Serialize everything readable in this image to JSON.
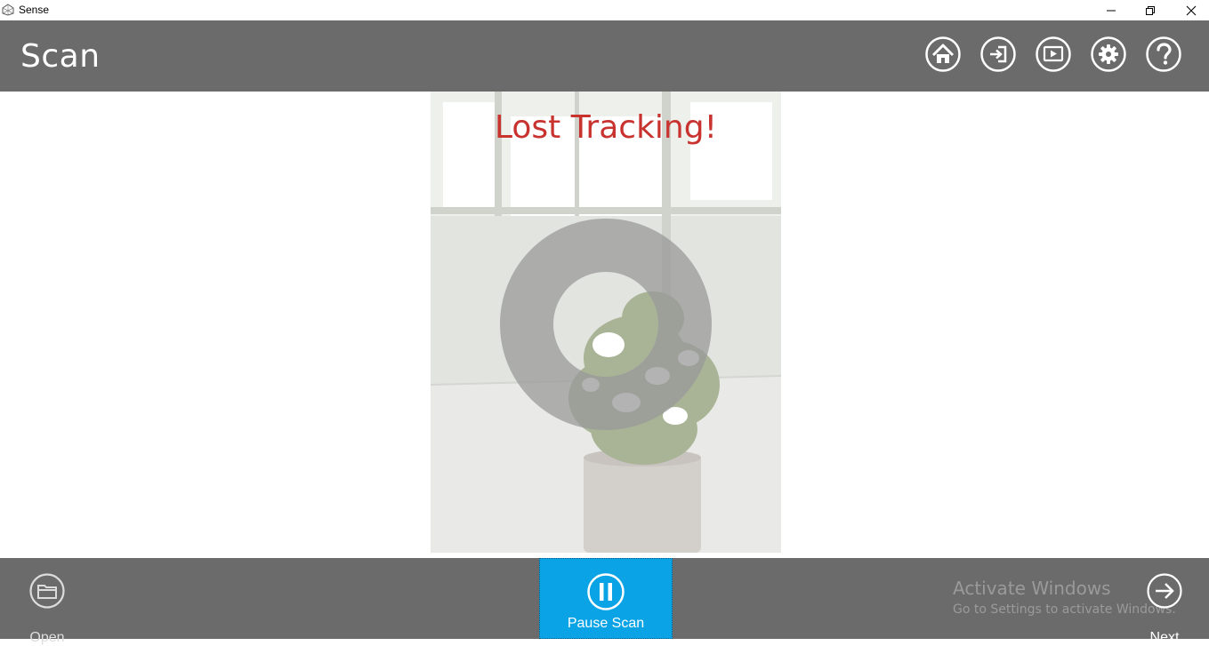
{
  "window": {
    "title": "Sense",
    "controls": [
      "minimize",
      "restore",
      "close"
    ]
  },
  "header": {
    "title": "Scan",
    "buttons": [
      {
        "icon": "home-icon"
      },
      {
        "icon": "sign-in-icon"
      },
      {
        "icon": "play-icon"
      },
      {
        "icon": "gear-icon"
      },
      {
        "icon": "help-icon"
      }
    ]
  },
  "viewport": {
    "status_message": "Lost Tracking!",
    "status_color": "#c8322f"
  },
  "bottombar": {
    "open_label": "Open",
    "pause_label": "Pause Scan",
    "next_label": "Next",
    "pause_color": "#0aa4e6"
  },
  "watermark": {
    "title": "Activate Windows",
    "subtitle": "Go to Settings to activate Windows."
  },
  "colors": {
    "bar": "#6b6b6b",
    "accent": "#0aa4e6"
  }
}
